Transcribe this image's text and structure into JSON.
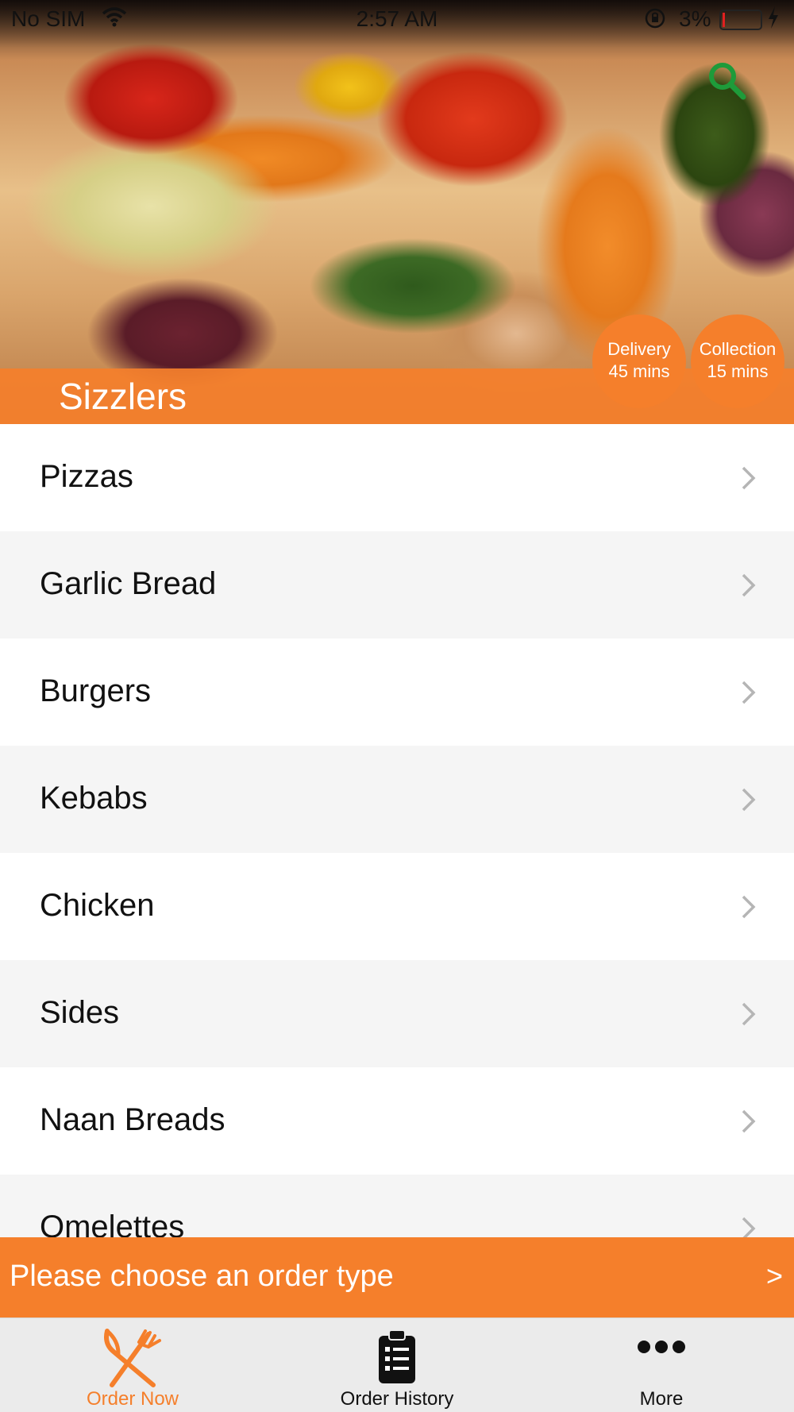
{
  "status_bar": {
    "carrier": "No SIM",
    "time": "2:57 AM",
    "battery_percent": "3%"
  },
  "hero": {
    "title": "Sizzlers",
    "delivery": {
      "label": "Delivery",
      "time": "45 mins"
    },
    "collection": {
      "label": "Collection",
      "time": "15 mins"
    }
  },
  "menu": {
    "items": [
      {
        "label": "Pizzas"
      },
      {
        "label": "Garlic Bread"
      },
      {
        "label": "Burgers"
      },
      {
        "label": "Kebabs"
      },
      {
        "label": "Chicken"
      },
      {
        "label": "Sides"
      },
      {
        "label": "Naan Breads"
      },
      {
        "label": "Omelettes"
      }
    ]
  },
  "order_bar": {
    "text": "Please choose an order type",
    "arrow": ">"
  },
  "tabbar": {
    "tabs": [
      {
        "label": "Order Now",
        "icon": "fork-knife-icon",
        "active": true
      },
      {
        "label": "Order History",
        "icon": "clipboard-icon",
        "active": false
      },
      {
        "label": "More",
        "icon": "more-dots-icon",
        "active": false
      }
    ]
  },
  "colors": {
    "accent": "#f57f2b",
    "search_icon": "#1e9b3a",
    "list_alt_row": "#f5f5f5",
    "tabbar_bg": "#ebebeb"
  }
}
